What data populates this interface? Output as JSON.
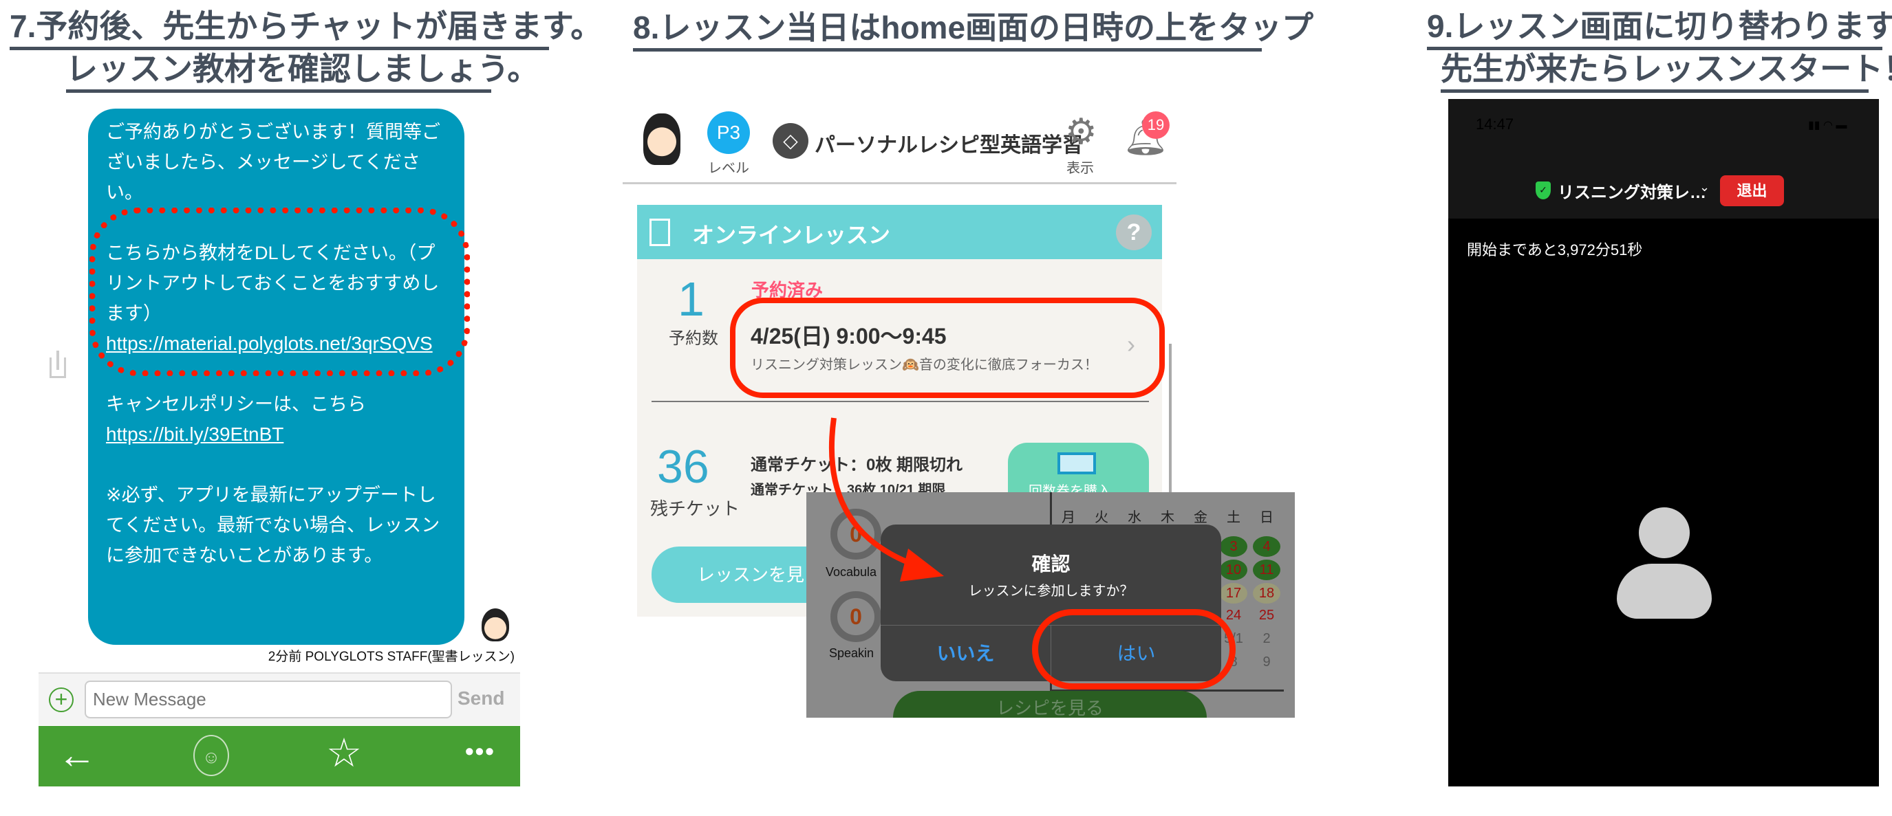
{
  "panel7": {
    "heading_line1": "7.予約後、先生からチャットが届きます。",
    "heading_line2": "レッスン教材を確認しましょう。",
    "message": {
      "greeting": "ご予約ありがとうございます！質問等ございましたら、メッセージしてください。",
      "download": "こちらから教材をDLしてください。（プリントアウトしておくことをおすすめします）",
      "material_link": "https://material.polyglots.net/3qrSQVS",
      "cancel_policy": "キャンセルポリシーは、こちら",
      "cancel_link": "https://bit.ly/39EtnBT",
      "note": "※必ず、アプリを最新にアップデートしてください。最新でない場合、レッスンに参加できないことがあります。"
    },
    "meta": "2分前  POLYGLOTS STAFF(聖書レッスン)",
    "input_placeholder": "New Message",
    "send_label": "Send",
    "bubble_color": "#0099bb",
    "nav_color": "#46a033",
    "nav_icons": [
      "arrow-left-icon",
      "robot-icon",
      "star-icon",
      "more-icon"
    ]
  },
  "panel8": {
    "heading": "8.レッスン当日はhome画面の日時の上をタップ",
    "level_badge": "P3",
    "level_label": "レベル",
    "app_title": "パーソナルレシピ型英語学習",
    "display_label": "表示",
    "notification_count": "19",
    "section_title": "オンラインレッスン",
    "help": "?",
    "reservation_count": "1",
    "reservation_label": "予約数",
    "reserved_status": "予約済み",
    "lesson_datetime": "4/25(日) 9:00〜9:45",
    "lesson_title": "リスニング対策レッスン🙉音の変化に徹底フォーカス！",
    "ticket_count": "36",
    "ticket_label": "残チケット",
    "ticket_line1": "通常チケット：0枚 期限切れ",
    "ticket_line2": "通常チケット：36枚 10/21 期限",
    "buy_button": "回数券を購入",
    "view_lessons_button": "レッスンを見",
    "skill_labels": [
      "Vocabula",
      "Speakin"
    ],
    "skill_values": [
      "0",
      "0"
    ],
    "weekdays": [
      "月",
      "火",
      "水",
      "木",
      "金",
      "土",
      "日"
    ],
    "cal_sat": [
      "3",
      "10",
      "17",
      "24",
      "5/1",
      "8"
    ],
    "cal_sun": [
      "4",
      "11",
      "18",
      "25",
      "2",
      "9"
    ],
    "dialog": {
      "title": "確認",
      "message": "レッスンに参加しますか？",
      "no": "いいえ",
      "yes": "はい"
    },
    "recipe_button": "レシピを見る",
    "accent_teal": "#6ad3d6",
    "highlight_red": "#ff2200"
  },
  "panel9": {
    "heading_line1": "9.レッスン画面に切り替わります。",
    "heading_line2": "先生が来たらレッスンスタート！",
    "status_time": "14:47",
    "lesson_title": "リスニング対策レ…",
    "exit_button": "退出",
    "countdown": "開始まであと3,972分51秒",
    "exit_color": "#e02828"
  }
}
